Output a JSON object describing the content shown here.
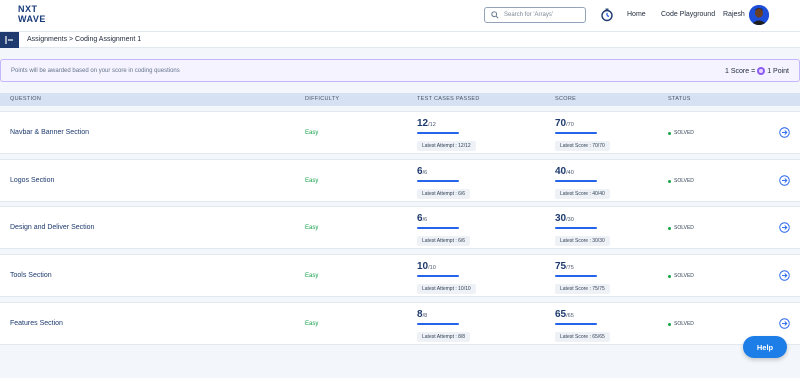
{
  "header": {
    "logo_line1": "NXT",
    "logo_line2": "WAVE",
    "search_placeholder": "Search for 'Arrays'",
    "nav": {
      "home": "Home",
      "code_playground": "Code Playground",
      "user_name": "Rajesh"
    }
  },
  "breadcrumb": "Assignments > Coding Assignment 1",
  "notice": {
    "message": "Points will be awarded based on your score in coding questions",
    "rate_left": "1 Score =",
    "rate_right": "1 Point"
  },
  "table": {
    "headers": {
      "question": "QUESTION",
      "difficulty": "DIFFICULTY",
      "tests": "TEST CASES PASSED",
      "score": "SCORE",
      "status": "STATUS"
    },
    "rows": [
      {
        "question": "Navbar & Banner Section",
        "difficulty": "Easy",
        "tests_passed": "12",
        "tests_total": "/12",
        "latest_attempt": "Latest Attempt : 12/12",
        "score": "70",
        "score_total": "/70",
        "latest_score": "Latest Score : 70/70",
        "status": "SOLVED"
      },
      {
        "question": "Logos Section",
        "difficulty": "Easy",
        "tests_passed": "6",
        "tests_total": "/6",
        "latest_attempt": "Latest Attempt : 6/6",
        "score": "40",
        "score_total": "/40",
        "latest_score": "Latest Score : 40/40",
        "status": "SOLVED"
      },
      {
        "question": "Design and Deliver Section",
        "difficulty": "Easy",
        "tests_passed": "6",
        "tests_total": "/6",
        "latest_attempt": "Latest Attempt : 6/6",
        "score": "30",
        "score_total": "/30",
        "latest_score": "Latest Score : 30/30",
        "status": "SOLVED"
      },
      {
        "question": "Tools Section",
        "difficulty": "Easy",
        "tests_passed": "10",
        "tests_total": "/10",
        "latest_attempt": "Latest Attempt : 10/10",
        "score": "75",
        "score_total": "/75",
        "latest_score": "Latest Score : 75/75",
        "status": "SOLVED"
      },
      {
        "question": "Features Section",
        "difficulty": "Easy",
        "tests_passed": "8",
        "tests_total": "/8",
        "latest_attempt": "Latest Attempt : 8/8",
        "score": "65",
        "score_total": "/65",
        "latest_score": "Latest Score : 65/65",
        "status": "SOLVED"
      }
    ]
  },
  "help_label": "Help",
  "colors": {
    "brand": "#1e3a6e",
    "accent": "#2563eb",
    "success": "#16a34a",
    "point_coin": "#8b5cf6"
  },
  "icons": [
    "search-icon",
    "clock-icon",
    "sidebar-collapse-icon",
    "point-coin-icon",
    "arrow-right-circle-icon"
  ]
}
